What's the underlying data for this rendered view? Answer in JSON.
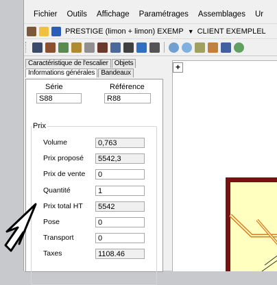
{
  "menu": [
    "Fichier",
    "Outils",
    "Affichage",
    "Paramétrages",
    "Assemblages",
    "Ur"
  ],
  "toolbar": {
    "project": "PRESTIGE (limon + limon) EXEMP",
    "client": "CLIENT EXEMPLEL",
    "dropdown_arrow": "▼"
  },
  "tabs": {
    "row1": [
      "Caractéristique de l'escalier",
      "Objets"
    ],
    "row2": [
      "Informations générales",
      "Bandeaux"
    ],
    "active": "Informations générales"
  },
  "serie": {
    "label": "Série",
    "value": "S88"
  },
  "reference": {
    "label": "Référence",
    "value": "R88"
  },
  "prix": {
    "title": "Prix",
    "rows": [
      {
        "label": "Volume",
        "value": "0,763",
        "readonly": true
      },
      {
        "label": "Prix proposé",
        "value": "5542,3",
        "readonly": true
      },
      {
        "label": "Prix de vente",
        "value": "0",
        "readonly": false
      },
      {
        "label": "Quantité",
        "value": "1",
        "readonly": false
      },
      {
        "label": "Prix total HT",
        "value": "5542",
        "readonly": true
      },
      {
        "label": "Pose",
        "value": "0",
        "readonly": false
      },
      {
        "label": "Transport",
        "value": "0",
        "readonly": false
      },
      {
        "label": "Taxes",
        "value": "1108.46",
        "readonly": true
      }
    ]
  },
  "canvas": {
    "add_button": "+"
  },
  "colors": {
    "frame_red": "#7a1010",
    "stair_fill": "#ffffc0",
    "stair_stroke": "#e07820"
  }
}
